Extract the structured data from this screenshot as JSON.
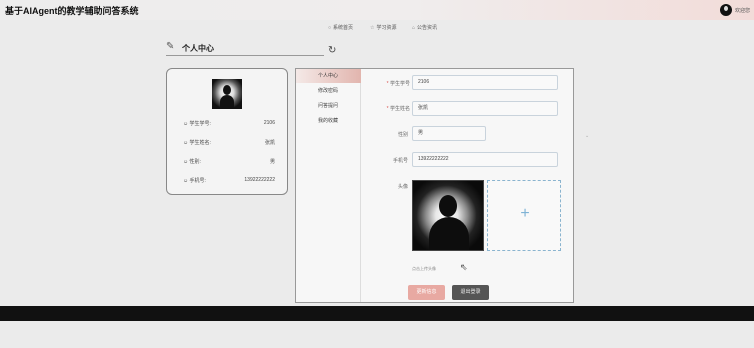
{
  "header": {
    "title": "基于AIAgent的教学辅助问答系统",
    "welcome": "欢迎您"
  },
  "nav": {
    "items": [
      {
        "label": "系统首页",
        "icon": "circle-icon"
      },
      {
        "label": "学习资源",
        "icon": "star-icon"
      },
      {
        "label": "公告资讯",
        "icon": "home-icon"
      }
    ]
  },
  "page": {
    "title": "个人中心"
  },
  "profile_card": {
    "rows": [
      {
        "label": "学生学号:",
        "value": "2106"
      },
      {
        "label": "学生姓名:",
        "value": "张凯"
      },
      {
        "label": "性别:",
        "value": "男"
      },
      {
        "label": "手机号:",
        "value": "13922222222"
      }
    ]
  },
  "side_menu": {
    "items": [
      {
        "label": "个人中心",
        "active": true
      },
      {
        "label": "修改密码",
        "active": false
      },
      {
        "label": "问答提问",
        "active": false
      },
      {
        "label": "我的收藏",
        "active": false
      }
    ]
  },
  "form": {
    "student_id_label": "学生学号",
    "student_id_value": "2106",
    "student_name_label": "学生姓名",
    "student_name_value": "张凯",
    "gender_label": "性别",
    "gender_value": "男",
    "phone_label": "手机号",
    "phone_value": "13922222222",
    "avatar_label": "头像",
    "upload_hint": "点击上传头像"
  },
  "actions": {
    "save_label": "更新信息",
    "logout_label": "退出登录"
  },
  "colors": {
    "accent": "#e2b5ae",
    "primary_button": "#e8a9a2",
    "dark_button": "#555555",
    "footer": "#111111"
  }
}
